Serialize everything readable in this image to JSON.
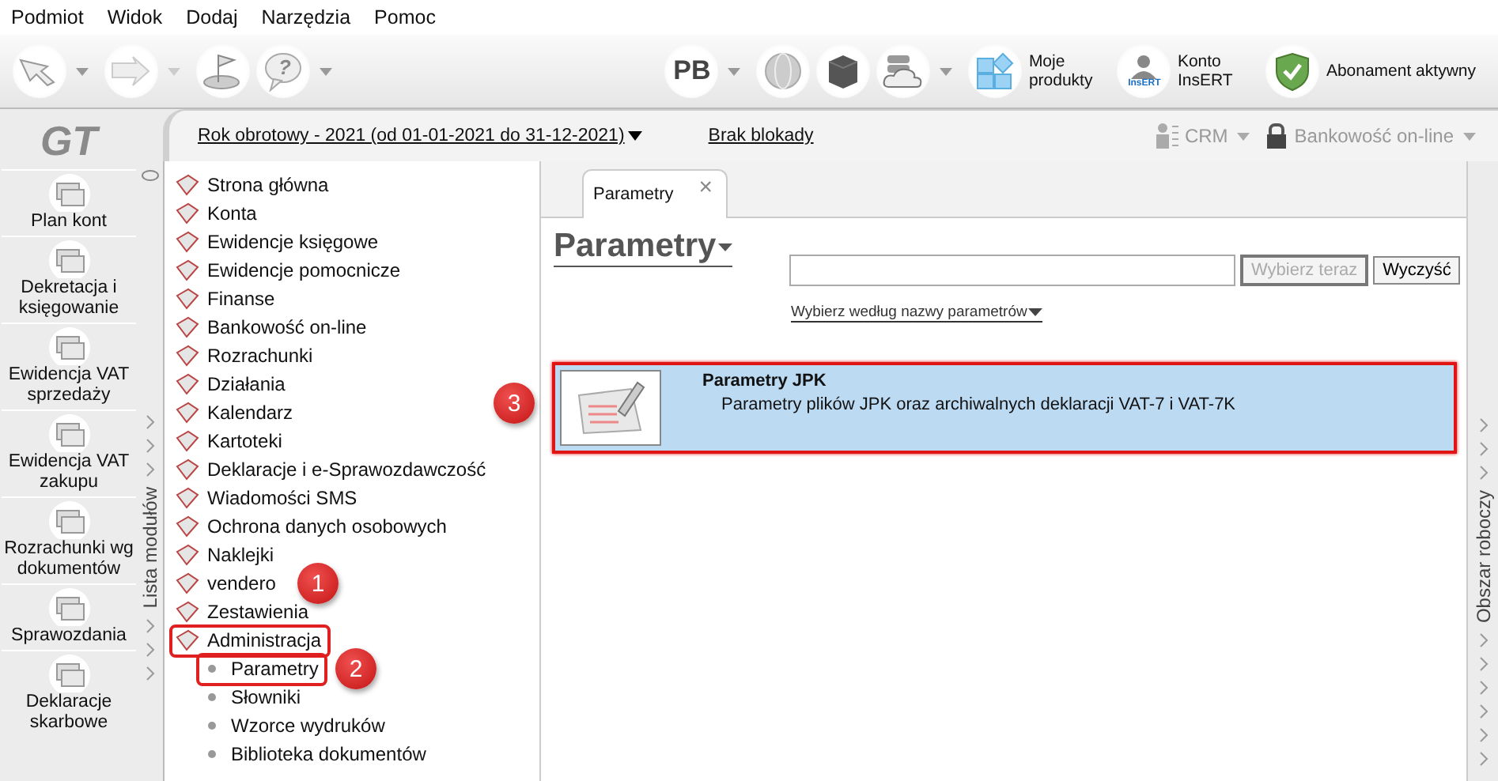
{
  "menu": [
    "Podmiot",
    "Widok",
    "Dodaj",
    "Narzędzia",
    "Pomoc"
  ],
  "toolbar": {
    "help": "?",
    "profile": "PB",
    "products": "Moje produkty",
    "account": "Konto InsERT",
    "account_badge": "InsERT",
    "subscription": "Abonament aktywny"
  },
  "logo": "GT",
  "left_nav": [
    "Plan kont",
    "Dekretacja i księgowanie",
    "Ewidencja VAT sprzedaży",
    "Ewidencja VAT zakupu",
    "Rozrachunki wg dokumentów",
    "Sprawozdania",
    "Deklaracje skarbowe"
  ],
  "header": {
    "fiscal_year": "Rok obrotowy - 2021  (od 01-01-2021 do 31-12-2021)",
    "lock": "Brak blokady",
    "crm": "CRM",
    "banking": "Bankowość on-line"
  },
  "module_list": {
    "title": "Lista modułów",
    "items": [
      {
        "label": "Strona główna",
        "highlighted": false
      },
      {
        "label": "Konta",
        "highlighted": false
      },
      {
        "label": "Ewidencje księgowe",
        "highlighted": false
      },
      {
        "label": "Ewidencje pomocnicze",
        "highlighted": false
      },
      {
        "label": "Finanse",
        "highlighted": false
      },
      {
        "label": "Bankowość on-line",
        "highlighted": false
      },
      {
        "label": "Rozrachunki",
        "highlighted": false
      },
      {
        "label": "Działania",
        "highlighted": false
      },
      {
        "label": "Kalendarz",
        "highlighted": false
      },
      {
        "label": "Kartoteki",
        "highlighted": false
      },
      {
        "label": "Deklaracje i e-Sprawozdawczość",
        "highlighted": false
      },
      {
        "label": "Wiadomości SMS",
        "highlighted": false
      },
      {
        "label": "Ochrona danych osobowych",
        "highlighted": false
      },
      {
        "label": "Naklejki",
        "highlighted": false
      },
      {
        "label": "vendero",
        "highlighted": false,
        "callout": "1"
      },
      {
        "label": "Zestawienia",
        "highlighted": false
      },
      {
        "label": "Administracja",
        "highlighted": true,
        "children": [
          {
            "label": "Parametry",
            "highlighted": true,
            "callout": "2"
          },
          {
            "label": "Słowniki",
            "highlighted": false
          },
          {
            "label": "Wzorce wydruków",
            "highlighted": false
          },
          {
            "label": "Biblioteka dokumentów",
            "highlighted": false
          }
        ]
      }
    ]
  },
  "tabs": [
    {
      "label": "Parametry",
      "selected": true,
      "close": "×"
    }
  ],
  "page_title": "Parametry",
  "search": {
    "select_button": "Wybierz teraz",
    "select_disabled": true,
    "clear_button": "Wyczyść",
    "filter_link": "Wybierz według nazwy parametrów"
  },
  "results": [
    {
      "title": "Parametry JPK",
      "description": "Parametry plików JPK oraz archiwalnych deklaracji VAT-7 i VAT-7K",
      "selected": true,
      "highlighted": true,
      "callout": "3"
    }
  ],
  "workspace": {
    "title": "Obszar roboczy"
  }
}
